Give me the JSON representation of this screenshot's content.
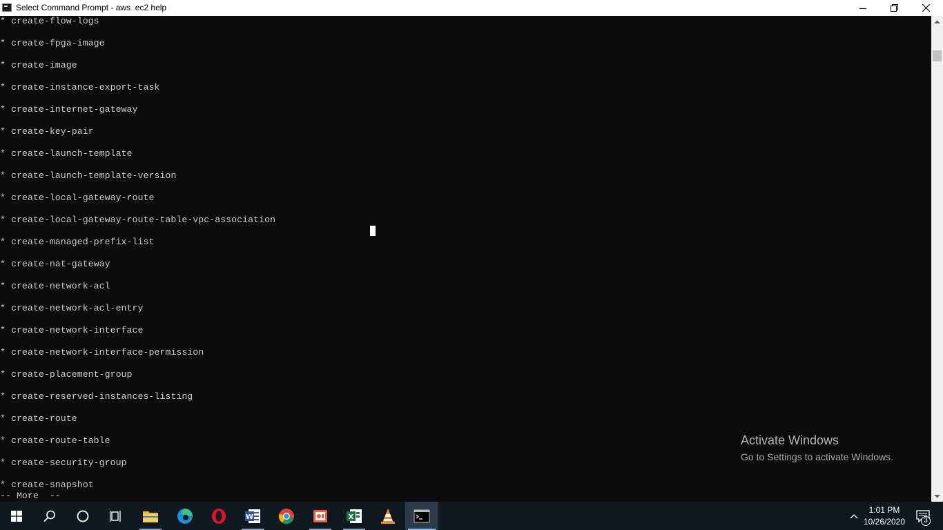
{
  "window": {
    "title": "Select Command Prompt - aws  ec2 help"
  },
  "console": {
    "lines": [
      "* create-flow-logs",
      "* create-fpga-image",
      "* create-image",
      "* create-instance-export-task",
      "* create-internet-gateway",
      "* create-key-pair",
      "* create-launch-template",
      "* create-launch-template-version",
      "* create-local-gateway-route",
      "* create-local-gateway-route-table-vpc-association",
      "* create-managed-prefix-list",
      "* create-nat-gateway",
      "* create-network-acl",
      "* create-network-acl-entry",
      "* create-network-interface",
      "* create-network-interface-permission",
      "* create-placement-group",
      "* create-reserved-instances-listing",
      "* create-route",
      "* create-route-table",
      "* create-security-group",
      "* create-snapshot"
    ],
    "more_prompt": "-- More  --",
    "text_color": "#cccccc",
    "background": "#0c0c0c"
  },
  "watermark": {
    "title": "Activate Windows",
    "subtitle": "Go to Settings to activate Windows."
  },
  "taskbar": {
    "items": [
      {
        "name": "start-button",
        "icon": "windows-logo-icon"
      },
      {
        "name": "search-button",
        "icon": "search-icon"
      },
      {
        "name": "cortana-button",
        "icon": "cortana-circle-icon"
      },
      {
        "name": "task-view-button",
        "icon": "task-view-icon"
      },
      {
        "name": "file-explorer-app",
        "icon": "folder-icon"
      },
      {
        "name": "edge-app",
        "icon": "edge-icon"
      },
      {
        "name": "opera-app",
        "icon": "opera-icon"
      },
      {
        "name": "word-app",
        "icon": "word-icon"
      },
      {
        "name": "chrome-app",
        "icon": "chrome-icon"
      },
      {
        "name": "recorder-app",
        "icon": "screen-recorder-icon"
      },
      {
        "name": "excel-app",
        "icon": "excel-icon"
      },
      {
        "name": "vlc-app",
        "icon": "vlc-cone-icon"
      },
      {
        "name": "command-prompt-app",
        "icon": "cmd-icon"
      }
    ],
    "clock": {
      "time": "1:01 PM",
      "date": "10/26/2020"
    },
    "notification_count": "3",
    "colors": {
      "background": "#101820",
      "active": "#2b3b4a"
    }
  }
}
